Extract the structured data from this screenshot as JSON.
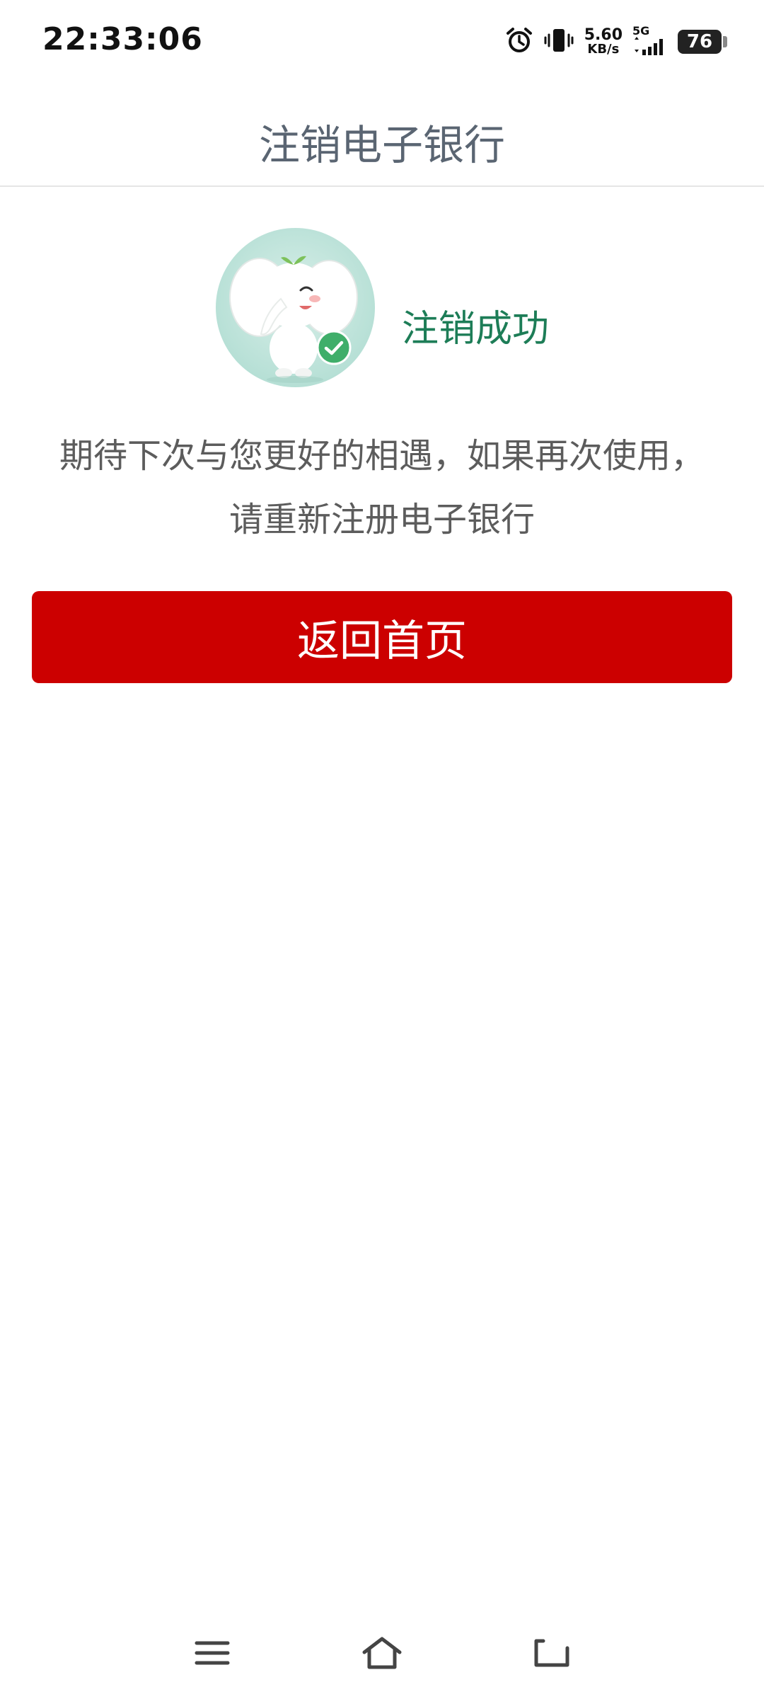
{
  "status_bar": {
    "time": "22:33:06",
    "net_speed_value": "5.60",
    "net_speed_unit": "KB/s",
    "network_type": "5G",
    "battery_level": "76"
  },
  "header": {
    "title": "注销电子银行"
  },
  "result": {
    "status_text": "注销成功",
    "message_line1": "期待下次与您更好的相遇，如果再次使用，",
    "message_line2": "请重新注册电子银行"
  },
  "actions": {
    "home_button_label": "返回首页"
  },
  "colors": {
    "primary_red": "#cc0000",
    "success_green": "#1d7d57",
    "title_gray": "#5a6572"
  },
  "icons": {
    "alarm": "alarm-icon",
    "vibrate": "vibrate-icon",
    "signal": "signal-icon",
    "mascot": "elephant-mascot-icon",
    "check": "check-icon",
    "menu": "menu-icon",
    "home": "home-icon",
    "back": "back-icon"
  }
}
